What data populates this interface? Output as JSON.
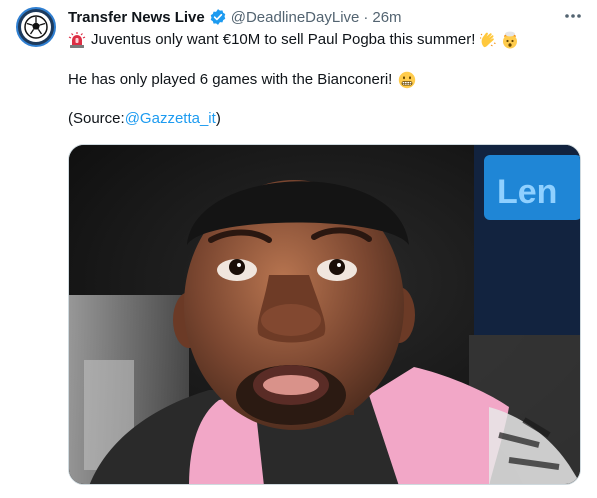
{
  "tweet": {
    "display_name": "Transfer News Live",
    "handle": "@DeadlineDayLive",
    "separator": "·",
    "timestamp": "26m",
    "line1_text": "Juventus only want €10M to sell Paul Pogba this summer!",
    "line2_text": "He has only played 6 games with the Bianconeri!",
    "source_prefix": "(Source: ",
    "source_mention": "@Gazzetta_it",
    "source_suffix": " )",
    "media_sign_text": "Len",
    "icons": {
      "avatar": "soccer-ball-icon",
      "verified": "verified-badge-icon",
      "more": "more-dots-icon",
      "line1_lead": "siren-emoji",
      "line1_trail": [
        "clapping-hands-emoji",
        "exploding-head-emoji"
      ],
      "line2_trail": "grimacing-face-emoji"
    },
    "colors": {
      "link": "#1d9bf0",
      "verified": "#1d9bf0",
      "secondary_text": "#536471",
      "primary_text": "#0f1419",
      "bib": "#f2a7c7"
    }
  }
}
